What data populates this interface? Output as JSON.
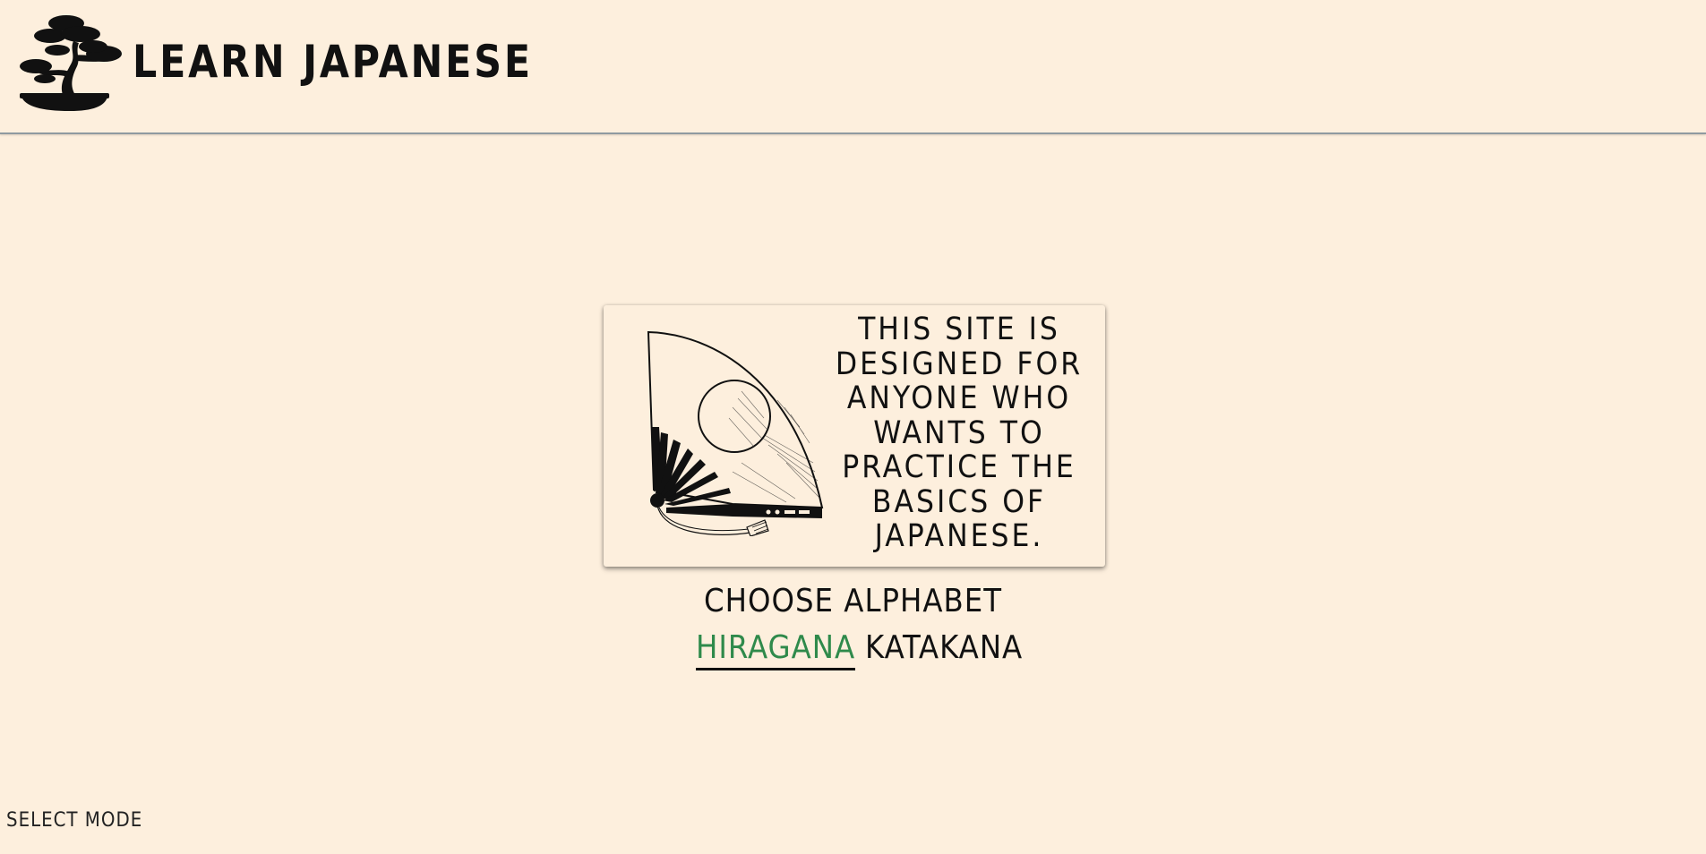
{
  "header": {
    "brand": "LEARN JAPANESE",
    "logo_icon": "bonsai-tree-icon"
  },
  "intro": {
    "text": "THIS SITE IS DESIGNED FOR ANYONE WHO WANTS TO PRACTICE THE BASICS OF JAPANESE.",
    "illustration_icon": "folding-fan-icon"
  },
  "alphabet": {
    "prompt": "CHOOSE ALPHABET",
    "options": [
      {
        "label": "HIRAGANA",
        "selected": true
      },
      {
        "label": "KATAKANA",
        "selected": false
      }
    ]
  },
  "footer": {
    "mode_label": "SELECT MODE"
  },
  "colors": {
    "background": "#fdefdd",
    "text": "#111111",
    "accent": "#2f8a4b"
  }
}
